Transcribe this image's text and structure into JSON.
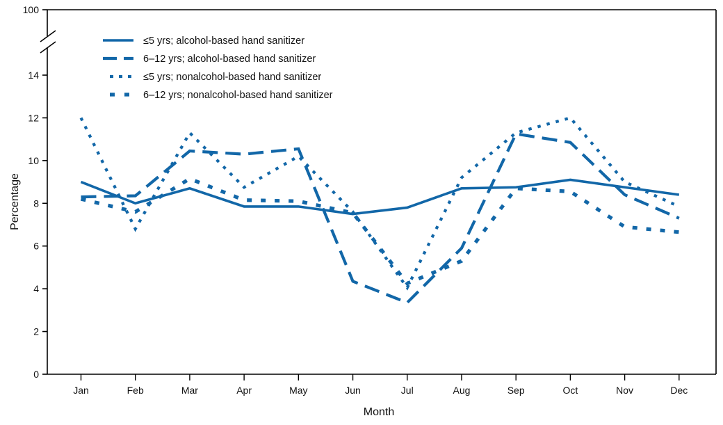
{
  "chart_data": {
    "type": "line",
    "title": "",
    "xlabel": "Month",
    "ylabel": "Percentage",
    "categories": [
      "Jan",
      "Feb",
      "Mar",
      "Apr",
      "May",
      "Jun",
      "Jul",
      "Aug",
      "Sep",
      "Oct",
      "Nov",
      "Dec"
    ],
    "ylim": [
      0,
      14
    ],
    "yticks": [
      0,
      2,
      4,
      6,
      8,
      10,
      12,
      14,
      100
    ],
    "ytick_labels": [
      "0",
      "2",
      "4",
      "6",
      "8",
      "10",
      "12",
      "14",
      "100"
    ],
    "axis_break": true,
    "axis_break_note": "y-axis broken between 14 and 100",
    "grid": false,
    "legend_position": "top-left-inside",
    "series": [
      {
        "name": "≤5 yrs;  alcohol-based hand sanitizer",
        "style": "solid",
        "color": "#1267A8",
        "values": [
          9.0,
          8.0,
          8.7,
          7.85,
          7.85,
          7.5,
          7.8,
          8.7,
          8.75,
          9.1,
          8.75,
          8.4
        ]
      },
      {
        "name": "6–12 yrs; alcohol-based hand sanitizer",
        "style": "dashed",
        "color": "#1267A8",
        "values": [
          8.3,
          8.35,
          10.45,
          10.3,
          10.55,
          4.35,
          3.35,
          5.9,
          11.25,
          10.85,
          8.4,
          7.3
        ]
      },
      {
        "name": "≤5 yrs;  nonalcohol-based hand sanitizer",
        "style": "dotted-fine",
        "color": "#1267A8",
        "values": [
          12.0,
          6.8,
          11.3,
          8.75,
          10.2,
          7.6,
          4.05,
          9.2,
          11.3,
          12.0,
          9.0,
          7.85
        ]
      },
      {
        "name": "6–12 yrs; nonalcohol-based hand sanitizer",
        "style": "dotted-thick",
        "color": "#1267A8",
        "values": [
          8.2,
          7.6,
          9.15,
          8.15,
          8.1,
          7.55,
          4.25,
          5.3,
          8.7,
          8.55,
          6.9,
          6.65
        ]
      }
    ]
  },
  "axes": {
    "y_title": "Percentage",
    "x_title": "Month",
    "y_ticks": [
      "100",
      "14",
      "12",
      "10",
      "8",
      "6",
      "4",
      "2",
      "0"
    ],
    "x_ticks": [
      "Jan",
      "Feb",
      "Mar",
      "Apr",
      "May",
      "Jun",
      "Jul",
      "Aug",
      "Sep",
      "Oct",
      "Nov",
      "Dec"
    ]
  },
  "legend": {
    "items": [
      {
        "label": "≤5 yrs;  alcohol-based hand sanitizer",
        "style": "solid"
      },
      {
        "label": "6–12 yrs; alcohol-based hand sanitizer",
        "style": "dashed"
      },
      {
        "label": "≤5 yrs;  nonalcohol-based hand sanitizer",
        "style": "dotted-fine"
      },
      {
        "label": "6–12 yrs; nonalcohol-based hand sanitizer",
        "style": "dotted-thick"
      }
    ]
  },
  "colors": {
    "series": "#1267A8",
    "axis": "#000000",
    "text": "#111111"
  }
}
